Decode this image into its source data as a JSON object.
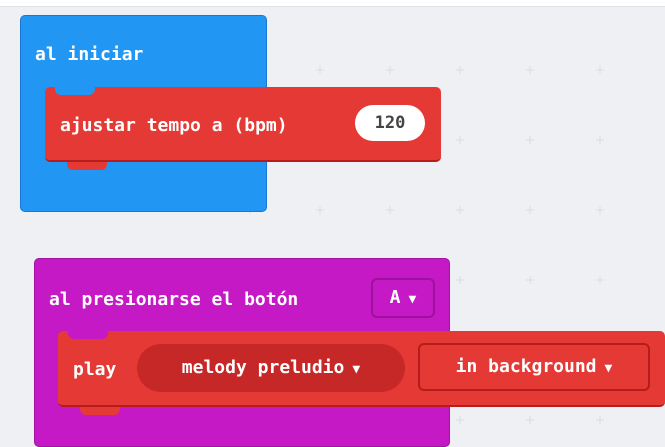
{
  "workspace": {
    "grid_color": "#d8dde3",
    "background": "#eef0f3"
  },
  "on_start": {
    "label": "al iniciar",
    "color": "#2196f3",
    "set_tempo": {
      "label": "ajustar tempo a (bpm)",
      "value": "120",
      "color": "#e53935"
    }
  },
  "on_button": {
    "label": "al presionarse el botón",
    "button_value": "A",
    "dropdown_icon": "caret-down-icon",
    "color": "#c619c6",
    "play": {
      "label": "play",
      "melody_value": "melody preludio",
      "mode_value": "in background",
      "color": "#e53935"
    }
  }
}
